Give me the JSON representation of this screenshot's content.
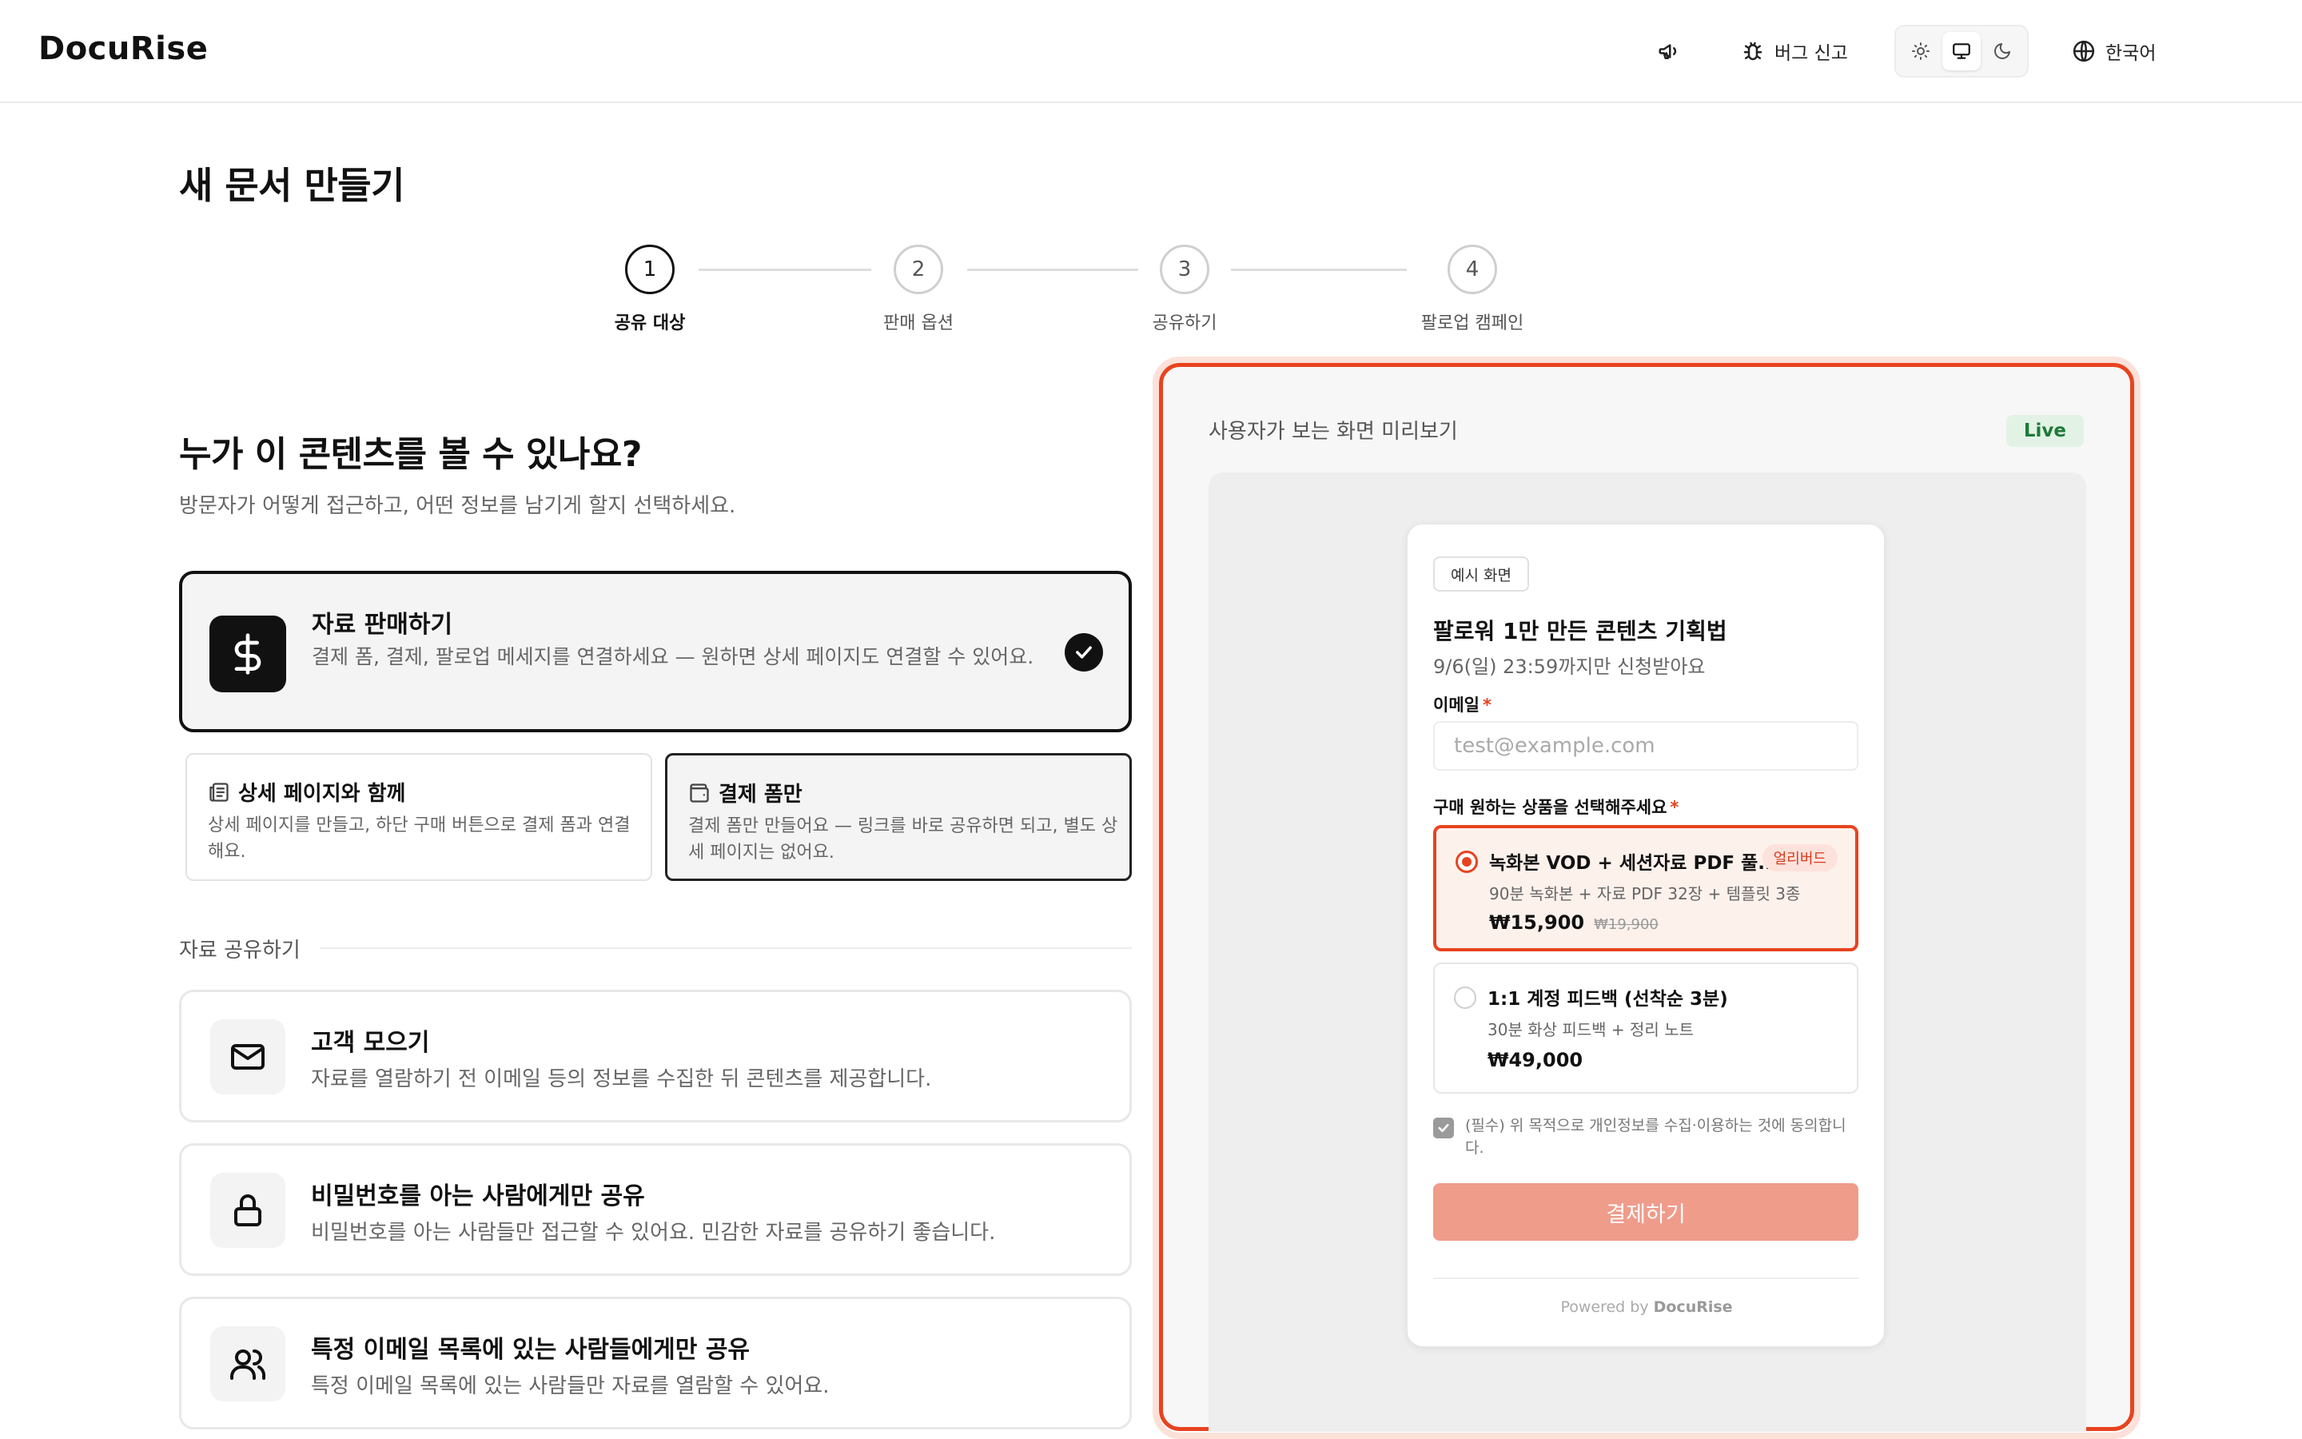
{
  "header": {
    "logo": "DocuRise",
    "bug_report_label": "버그 신고",
    "language_label": "한국어",
    "theme_active": "system"
  },
  "page": {
    "title": "새 문서 만들기"
  },
  "steps": [
    {
      "number": "1",
      "label": "공유 대상",
      "active": true
    },
    {
      "number": "2",
      "label": "판매 옵션",
      "active": false
    },
    {
      "number": "3",
      "label": "공유하기",
      "active": false
    },
    {
      "number": "4",
      "label": "팔로업 캠페인",
      "active": false
    }
  ],
  "audience": {
    "question": "누가 이 콘텐츠를 볼 수 있나요?",
    "subtitle": "방문자가 어떻게 접근하고, 어떤 정보를 남기게 할지 선택하세요.",
    "sell": {
      "title": "자료 판매하기",
      "description": "결제 폼, 결제, 팔로업 메세지를 연결하세요 — 원하면 상세 페이지도 연결할 수 있어요.",
      "selected": true
    },
    "sell_modes": [
      {
        "title": "상세 페이지와 함께",
        "description": "상세 페이지를 만들고, 하단 구매 버튼으로 결제 폼과 연결해요.",
        "selected": false
      },
      {
        "title": "결제 폼만",
        "description": "결제 폼만 만들어요 — 링크를 바로 공유하면 되고, 별도 상세 페이지는 없어요.",
        "selected": true
      }
    ],
    "share_section_label": "자료 공유하기",
    "share_options": [
      {
        "title": "고객 모으기",
        "description": "자료를 열람하기 전 이메일 등의 정보를 수집한 뒤 콘텐츠를 제공합니다.",
        "icon": "mail-icon"
      },
      {
        "title": "비밀번호를 아는 사람에게만 공유",
        "description": "비밀번호를 아는 사람들만 접근할 수 있어요. 민감한 자료를 공유하기 좋습니다.",
        "icon": "lock-icon"
      },
      {
        "title": "특정 이메일 목록에 있는 사람들에게만 공유",
        "description": "특정 이메일 목록에 있는 사람들만 자료를 열람할 수 있어요.",
        "icon": "users-icon"
      }
    ]
  },
  "preview": {
    "title": "사용자가 보는 화면 미리보기",
    "live_badge": "Live",
    "card": {
      "badge": "예시 화면",
      "heading": "팔로워 1만 만든 콘텐츠 기획법",
      "deadline": "9/6(일) 23:59까지만 신청받아요",
      "email_label": "이메일",
      "email_placeholder": "test@example.com",
      "product_label": "구매 원하는 상품을 선택해주세요",
      "products": [
        {
          "name": "녹화본 VOD + 세션자료 PDF 풀...",
          "tag": "얼리버드",
          "description": "90분 녹화본 + 자료 PDF 32장 + 템플릿 3종",
          "price": "₩15,900",
          "original_price": "₩19,900",
          "selected": true
        },
        {
          "name": "1:1 계정 피드백 (선착순 3분)",
          "tag": "",
          "description": "30분 화상 피드백 + 정리 노트",
          "price": "₩49,000",
          "original_price": "",
          "selected": false
        }
      ],
      "consent": "(필수) 위 목적으로 개인정보를 수집·이용하는 것에 동의합니다.",
      "pay_button": "결제하기",
      "powered_prefix": "Powered by",
      "powered_brand": "DocuRise"
    }
  },
  "colors": {
    "accent": "#e8431f",
    "pay_button": "#ef9c8b",
    "live": "#1e7a38"
  }
}
